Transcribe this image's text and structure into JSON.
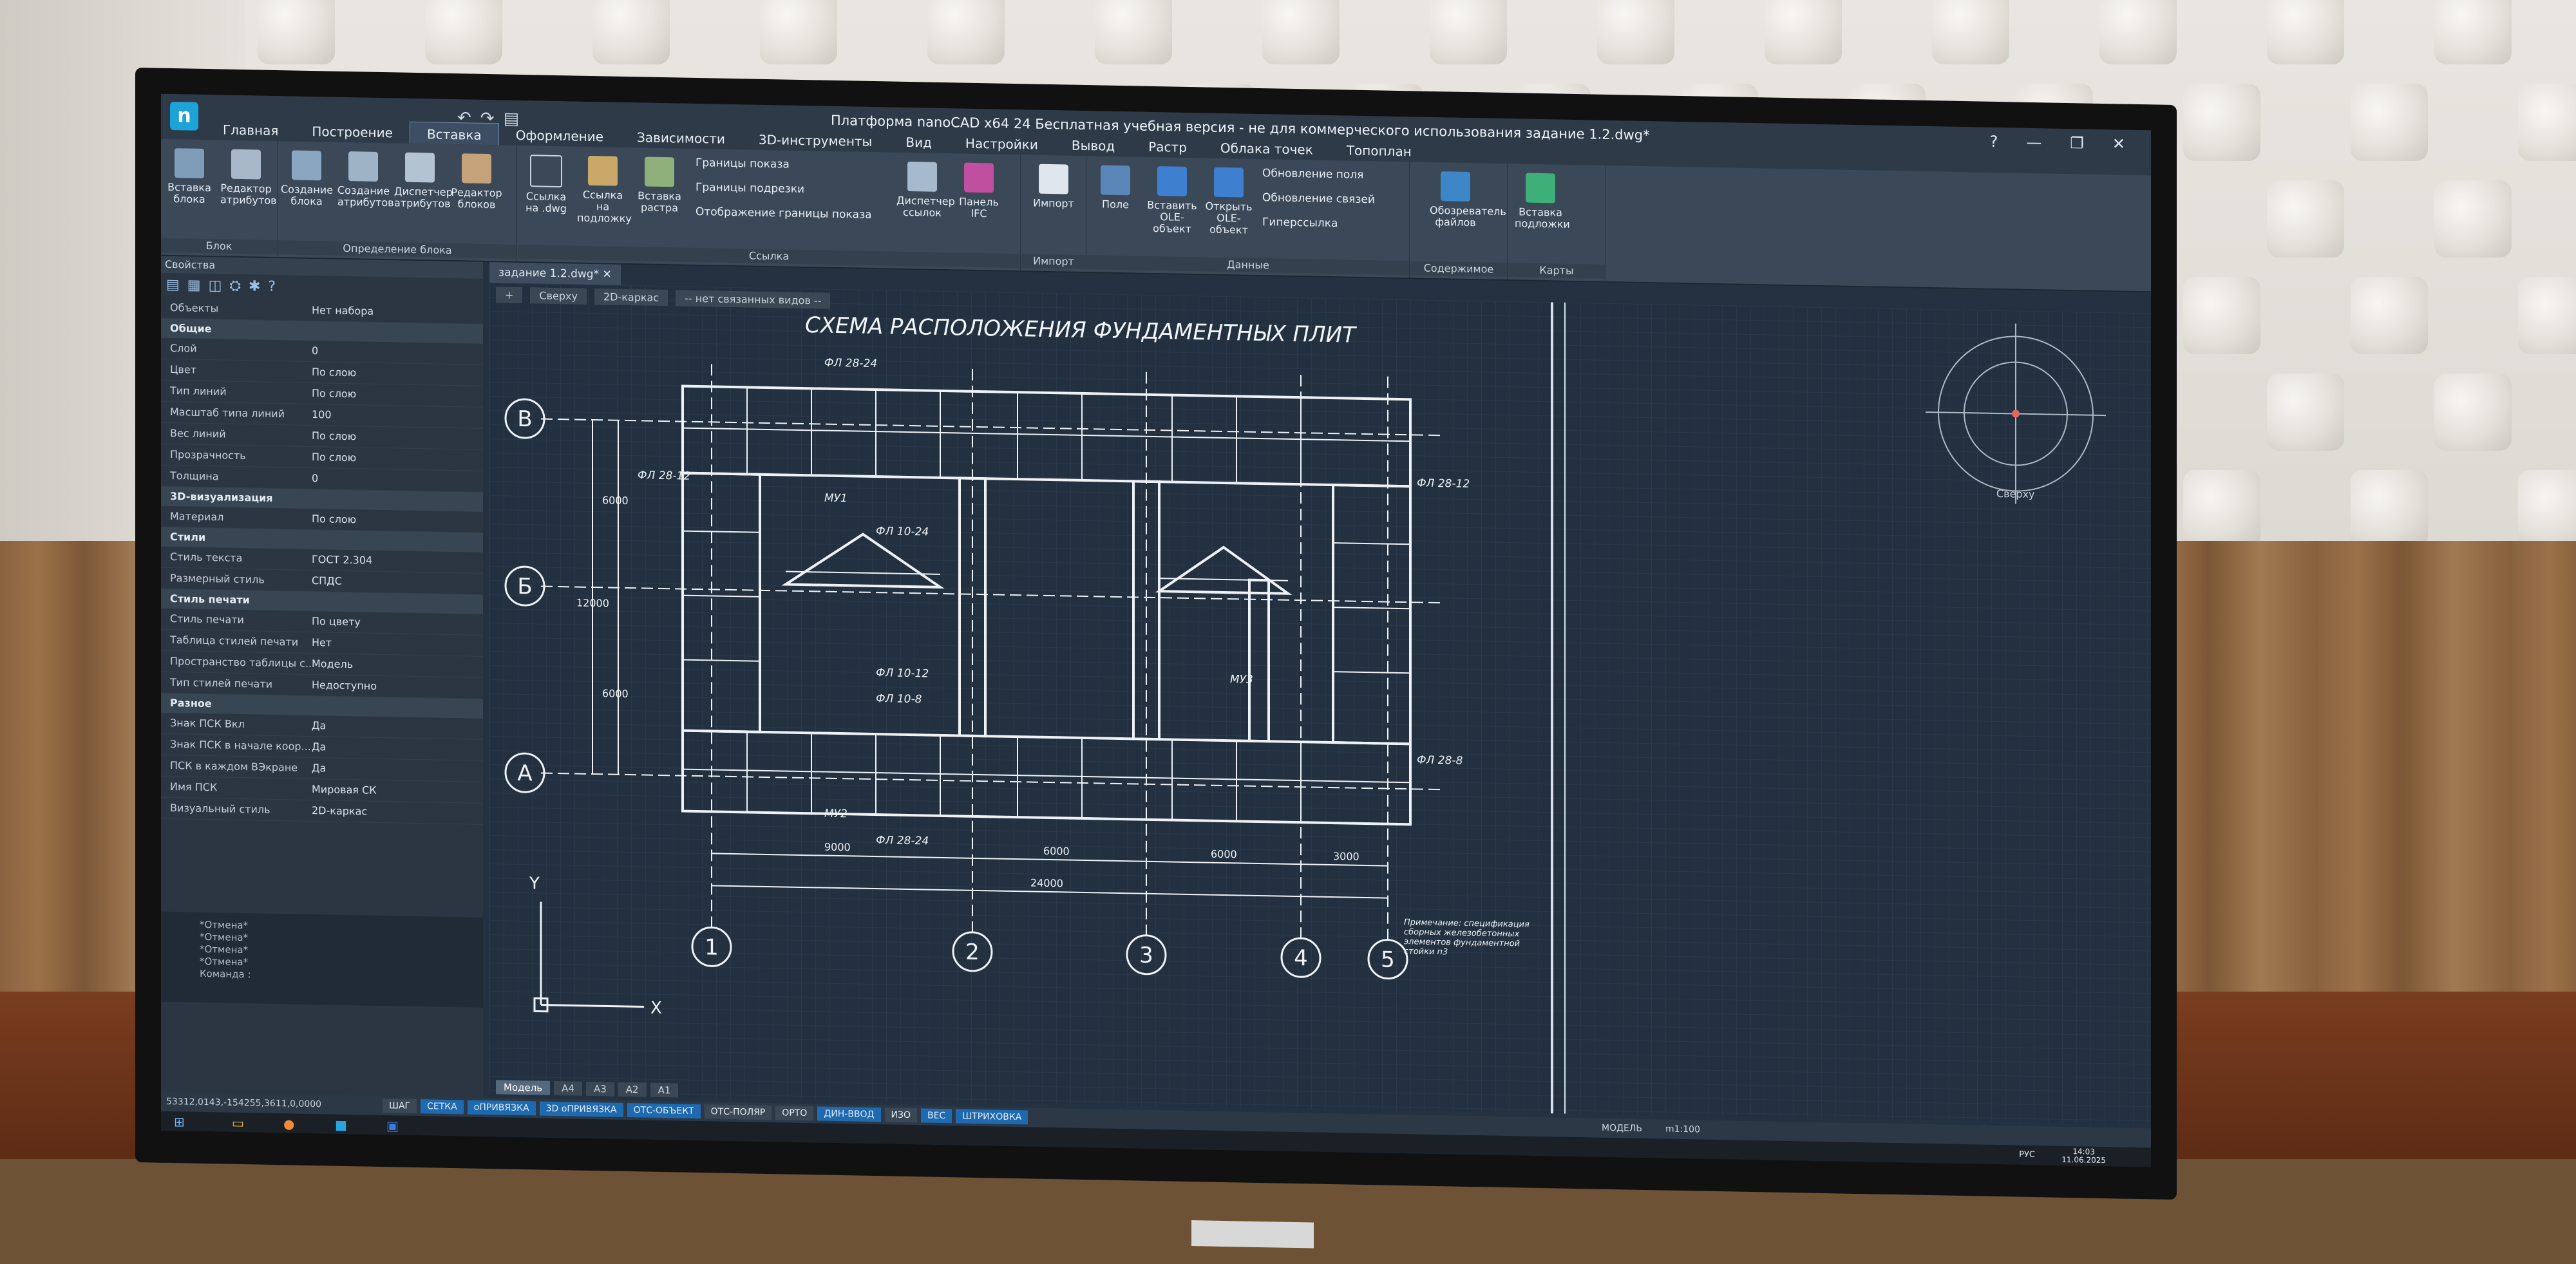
{
  "window": {
    "title": "Платформа nanoCAD x64 24  Бесплатная учебная версия - не для коммерческого использования задание 1.2.dwg*",
    "doc_tab": "задание 1.2.dwg*"
  },
  "ribbon_tabs": [
    "Главная",
    "Построение",
    "Вставка",
    "Оформление",
    "Зависимости",
    "3D-инструменты",
    "Вид",
    "Настройки",
    "Вывод",
    "Растр",
    "Облака точек",
    "Топоплан"
  ],
  "ribbon": {
    "block": {
      "title": "Блок",
      "b1": "Вставка блока",
      "b2": "Редактор атрибутов"
    },
    "attr": {
      "title": "Определение блока",
      "b1": "Создание блока",
      "b2": "Создание атрибутов",
      "b3": "Диспетчер атрибутов",
      "b4": "Редактор блоков"
    },
    "link": {
      "title": "Ссылка",
      "b1": "Ссылка на .dwg",
      "b2": "Ссылка на подложку",
      "b3": "Вставка растра",
      "s1": "Границы показа",
      "s2": "Границы подрезки",
      "s3": "Отображение границы показа",
      "b4": "Диспетчер ссылок",
      "b5": "Панель IFC"
    },
    "import": {
      "title": "Импорт",
      "b1": "Импорт"
    },
    "data": {
      "title": "Данные",
      "b1": "Поле",
      "b2": "Вставить OLE-объект",
      "b3": "Открыть OLE-объект",
      "s1": "Обновление поля",
      "s2": "Обновление связей",
      "s3": "Гиперссылка"
    },
    "content": {
      "title": "Содержимое",
      "b1": "Обозреватель файлов"
    },
    "maps": {
      "title": "Карты",
      "b1": "Вставка подложки"
    }
  },
  "properties": {
    "header": "Свойства",
    "rows": [
      {
        "type": "row",
        "k": "Объекты",
        "v": "Нет набора"
      },
      {
        "type": "sec",
        "k": "Общие"
      },
      {
        "type": "row",
        "k": "Слой",
        "v": "0"
      },
      {
        "type": "row",
        "k": "Цвет",
        "v": "По слою"
      },
      {
        "type": "row",
        "k": "Тип линий",
        "v": "По слою"
      },
      {
        "type": "row",
        "k": "Масштаб типа линий",
        "v": "100"
      },
      {
        "type": "row",
        "k": "Вес линий",
        "v": "По слою"
      },
      {
        "type": "row",
        "k": "Прозрачность",
        "v": "По слою"
      },
      {
        "type": "row",
        "k": "Толщина",
        "v": "0"
      },
      {
        "type": "sec",
        "k": "3D-визуализация"
      },
      {
        "type": "row",
        "k": "Материал",
        "v": "По слою"
      },
      {
        "type": "sec",
        "k": "Стили"
      },
      {
        "type": "row",
        "k": "Стиль текста",
        "v": "ГОСТ 2.304"
      },
      {
        "type": "row",
        "k": "Размерный стиль",
        "v": "СПДС"
      },
      {
        "type": "sec",
        "k": "Стиль печати"
      },
      {
        "type": "row",
        "k": "Стиль печати",
        "v": "По цвету"
      },
      {
        "type": "row",
        "k": "Таблица стилей печати",
        "v": "Нет"
      },
      {
        "type": "row",
        "k": "Пространство таблицы с...",
        "v": "Модель"
      },
      {
        "type": "row",
        "k": "Тип стилей печати",
        "v": "Недоступно"
      },
      {
        "type": "sec",
        "k": "Разное"
      },
      {
        "type": "row",
        "k": "Знак ПСК Вкл",
        "v": "Да"
      },
      {
        "type": "row",
        "k": "Знак ПСК в начале коор...",
        "v": "Да"
      },
      {
        "type": "row",
        "k": "ПСК в каждом ВЭкране",
        "v": "Да"
      },
      {
        "type": "row",
        "k": "Имя ПСК",
        "v": "Мировая СК"
      },
      {
        "type": "row",
        "k": "Визуальный стиль",
        "v": "2D-каркас"
      }
    ]
  },
  "command_history": [
    "*Отмена*",
    "*Отмена*",
    "*Отмена*",
    "*Отмена*",
    "Команда :"
  ],
  "view_bar": [
    "+",
    "Сверху",
    "2D-каркас",
    "-- нет связанных видов --"
  ],
  "drawing": {
    "title": "СХЕМА РАСПОЛОЖЕНИЯ ФУНДАМЕНТНЫХ ПЛИТ",
    "axes_rows": [
      "В",
      "Б",
      "А"
    ],
    "axes_cols": [
      "1",
      "2",
      "3",
      "4",
      "5"
    ],
    "dims": {
      "d1": "9000",
      "d2": "6000",
      "d3": "6000",
      "d4": "3000",
      "total": "24000",
      "v1": "6000",
      "v2": "12000",
      "v3": "6000"
    },
    "labels": {
      "fl1": "ФЛ 28-24",
      "fl2": "ФЛ 28-12",
      "fl3": "ФЛ 10-24",
      "fl4": "ФЛ 10-12",
      "fl5": "ФЛ 10-8",
      "fl6": "ФЛ 28-8",
      "fl7": "ФЛ 28-24",
      "fl8": "ФЛ 28-12",
      "mu1": "МУ1",
      "mu2": "МУ2",
      "mu3": "МУ3"
    },
    "note": "Примечание: спецификация сборных железобетонных элементов фундаментной стойки п3",
    "ucs_x": "X",
    "ucs_y": "Y",
    "viewcube": "Сверху"
  },
  "model_tabs": [
    "Модель",
    "A4",
    "A3",
    "A2",
    "A1"
  ],
  "status": {
    "coords": "53312,0143,-154255,3611,0,0000",
    "buttons": [
      {
        "label": "ШАГ",
        "on": false
      },
      {
        "label": "СЕТКА",
        "on": true
      },
      {
        "label": "оПРИВЯЗКА",
        "on": true
      },
      {
        "label": "3D оПРИВЯЗКА",
        "on": true
      },
      {
        "label": "ОТС-ОБЪЕКТ",
        "on": true
      },
      {
        "label": "ОТС-ПОЛЯР",
        "on": false
      },
      {
        "label": "ОРТО",
        "on": false
      },
      {
        "label": "ДИН-ВВОД",
        "on": true
      },
      {
        "label": "ИЗО",
        "on": false
      },
      {
        "label": "ВЕС",
        "on": true
      },
      {
        "label": "ШТРИХОВКА",
        "on": true
      }
    ],
    "mode": "МОДЕЛЬ",
    "scale": "m1:100"
  },
  "taskbar": {
    "lang": "РУС",
    "time": "14:03",
    "date": "11.06.2025"
  }
}
